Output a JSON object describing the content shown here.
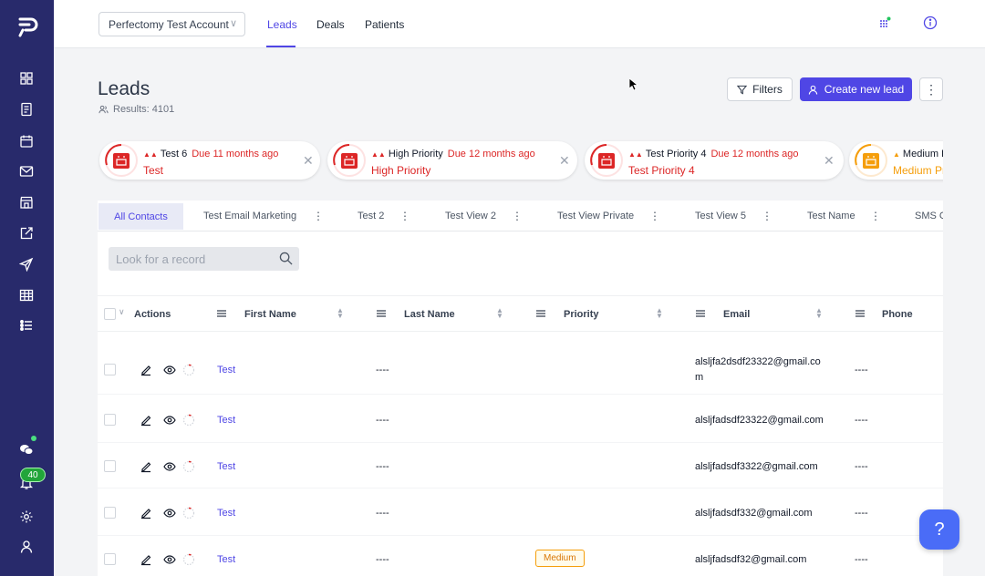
{
  "topbar": {
    "account": "Perfectomy Test Account",
    "tabs": [
      "Leads",
      "Deals",
      "Patients"
    ],
    "active_tab": "Leads"
  },
  "sidebar": {
    "icons": [
      "dashboard-icon",
      "document-icon",
      "calendar-icon",
      "mail-icon",
      "store-icon",
      "edit-external-icon",
      "send-icon",
      "table-icon",
      "list-icon",
      "chat-icon",
      "bell-icon",
      "gear-icon",
      "user-icon"
    ],
    "notification_count": "40"
  },
  "page": {
    "title": "Leads",
    "results": "Results: 4101",
    "filters_label": "Filters",
    "create_label": "Create new lead",
    "more_label": "⋮"
  },
  "cards": [
    {
      "title": "Test 6",
      "due": "Due 11 months ago",
      "sub": "Test",
      "arrows": "▲▲"
    },
    {
      "title": "High Priority",
      "due": "Due 12 months ago",
      "sub": "High Priority",
      "arrows": "▲▲"
    },
    {
      "title": "Test Priority 4",
      "due": "Due 12 months ago",
      "sub": "Test Priority 4",
      "arrows": "▲▲"
    },
    {
      "title": "Medium P",
      "due": "",
      "sub": "Medium Pr",
      "arrows": "▲"
    }
  ],
  "views": [
    "All Contacts",
    "Test Email Marketing",
    "Test 2",
    "Test View 2",
    "Test View Private",
    "Test View 5",
    "Test Name",
    "SMS C"
  ],
  "search": {
    "placeholder": "Look for a record"
  },
  "table": {
    "columns": [
      "Actions",
      "First Name",
      "Last Name",
      "Priority",
      "Email",
      "Phone"
    ],
    "rows": [
      {
        "first": "Test",
        "last": "----",
        "priority": "",
        "email": "alsljfa2dsdf23322@gmail.co",
        "email2": "m",
        "phone": "----"
      },
      {
        "first": "Test",
        "last": "----",
        "priority": "",
        "email": "alsljfadsdf23322@gmail.com",
        "email2": "",
        "phone": "----"
      },
      {
        "first": "Test",
        "last": "----",
        "priority": "",
        "email": "alsljfadsdf3322@gmail.com",
        "email2": "",
        "phone": "----"
      },
      {
        "first": "Test",
        "last": "----",
        "priority": "",
        "email": "alsljfadsdf332@gmail.com",
        "email2": "",
        "phone": "----"
      },
      {
        "first": "Test",
        "last": "----",
        "priority": "Medium",
        "email": "alsljfadsdf32@gmail.com",
        "email2": "",
        "phone": "----"
      }
    ]
  },
  "help": {
    "label": "?"
  },
  "colors": {
    "sidebar": "#282a6b",
    "accent": "#4f46e5",
    "danger": "#dc2626",
    "warning": "#f59e0b"
  }
}
